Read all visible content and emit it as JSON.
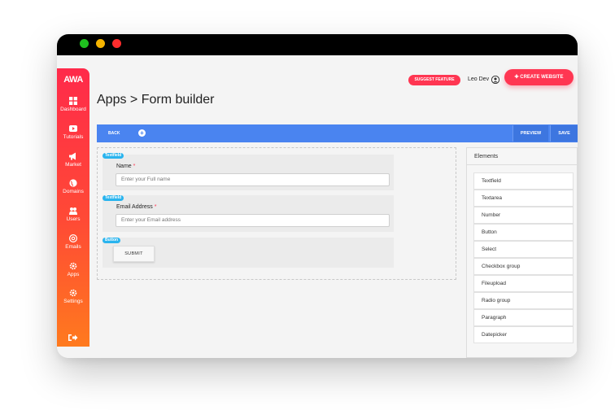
{
  "window": {
    "controls": [
      "green",
      "yellow",
      "red"
    ]
  },
  "sidebar": {
    "logo": "AWA",
    "items": [
      {
        "label": "Dashboard",
        "icon": "dashboard-icon"
      },
      {
        "label": "Tutorials",
        "icon": "play-icon"
      },
      {
        "label": "Market",
        "icon": "megaphone-icon"
      },
      {
        "label": "Domains",
        "icon": "globe-icon"
      },
      {
        "label": "Users",
        "icon": "users-icon"
      },
      {
        "label": "Emails",
        "icon": "at-icon"
      },
      {
        "label": "Apps",
        "icon": "gear-icon"
      },
      {
        "label": "Settings",
        "icon": "settings-icon"
      }
    ],
    "logout_icon": "logout-icon"
  },
  "header": {
    "suggest_label": "SUGGEST FEATURE",
    "user_name": "Leo Dev",
    "create_label": "CREATE WEBSITE"
  },
  "page": {
    "title": "Apps > Form builder"
  },
  "toolbar": {
    "back_label": "BACK",
    "preview_label": "PREVIEW",
    "save_label": "SAVE"
  },
  "form": {
    "fields": [
      {
        "tag": "Textfield",
        "label": "Name",
        "required": "*",
        "placeholder": "Enter your Full name"
      },
      {
        "tag": "Textfield",
        "label": "Email Address",
        "required": "*",
        "placeholder": "Enter your Email address"
      }
    ],
    "button": {
      "tag": "Button",
      "label": "SUBMIT"
    }
  },
  "elements_panel": {
    "title": "Elements",
    "items": [
      "Textfield",
      "Textarea",
      "Number",
      "Button",
      "Select",
      "Checkbox group",
      "Fileupload",
      "Radio group",
      "Paragraph",
      "Datepicker"
    ]
  },
  "colors": {
    "accent": "#ff3652",
    "toolbar": "#4a84f0",
    "tag": "#2ab4ee"
  }
}
